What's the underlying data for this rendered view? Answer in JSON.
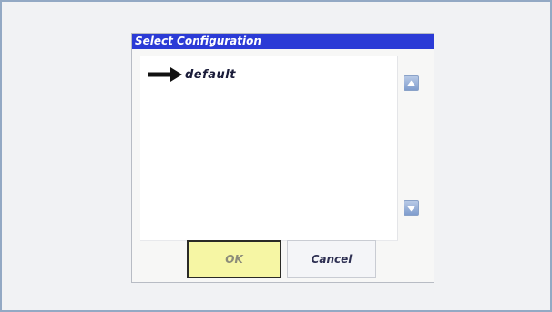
{
  "dialog": {
    "title": "Select Configuration",
    "list": {
      "items": [
        {
          "label": "default",
          "selected": true,
          "marker_icon": "arrow-right-icon"
        }
      ]
    },
    "scroll_up_icon": "arrow-up-icon",
    "scroll_down_icon": "arrow-down-icon",
    "buttons": {
      "ok_label": "OK",
      "cancel_label": "Cancel"
    }
  },
  "colors": {
    "title_bar": "#2b3bd6",
    "ok_button": "#f6f6a4",
    "scroll_button": "#8fa9d6"
  }
}
